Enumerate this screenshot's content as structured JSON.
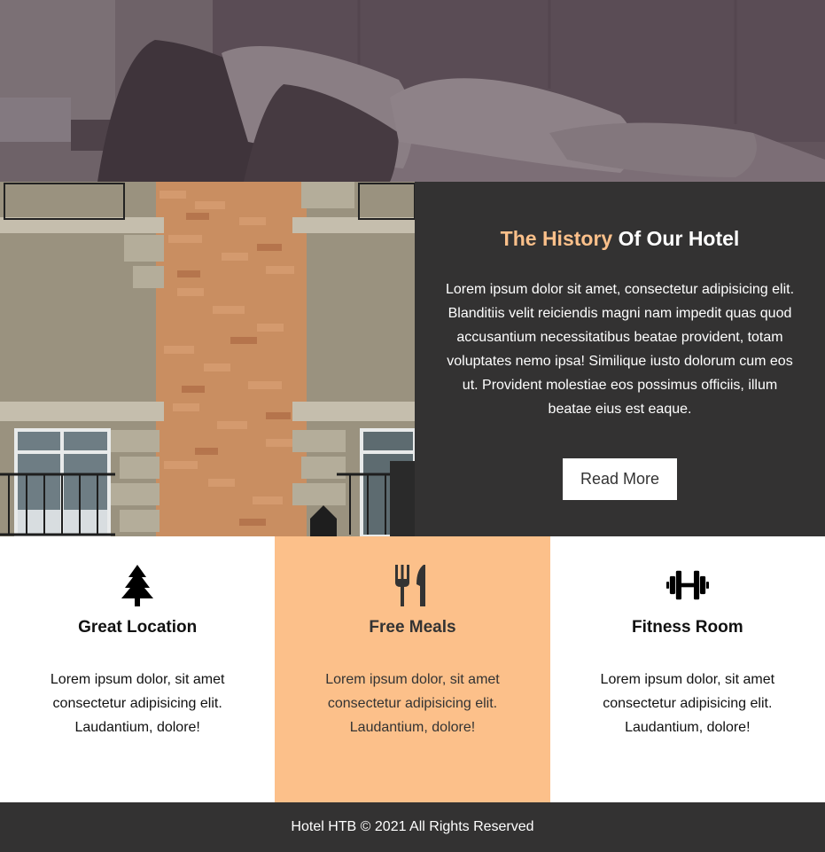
{
  "hero": {
    "image": "hotel-bedroom-pillows"
  },
  "history": {
    "image": "hotel-building-facade",
    "title_accent": "The History",
    "title_rest": " Of Our Hotel",
    "text": "Lorem ipsum dolor sit amet, consectetur adipisicing elit. Blanditiis velit reiciendis magni nam impedit quas quod accusantium necessitatibus beatae provident, totam voluptates nemo ipsa! Similique iusto dolorum cum eos ut. Provident molestiae eos possimus officiis, illum beatae eius est eaque.",
    "button_label": "Read More"
  },
  "features": [
    {
      "icon": "tree-icon",
      "title": "Great Location",
      "text": "Lorem ipsum dolor, sit amet consectetur adipisicing elit. Laudantium, dolore!"
    },
    {
      "icon": "utensils-icon",
      "title": "Free Meals",
      "text": "Lorem ipsum dolor, sit amet consectetur adipisicing elit. Laudantium, dolore!"
    },
    {
      "icon": "dumbbell-icon",
      "title": "Fitness Room",
      "text": "Lorem ipsum dolor, sit amet consectetur adipisicing elit. Laudantium, dolore!"
    }
  ],
  "footer": {
    "text": "Hotel HTB © 2021 All Rights Reserved"
  },
  "colors": {
    "accent": "#fcc08a",
    "dark": "#333232",
    "hero_overlay": "#5e5058"
  }
}
